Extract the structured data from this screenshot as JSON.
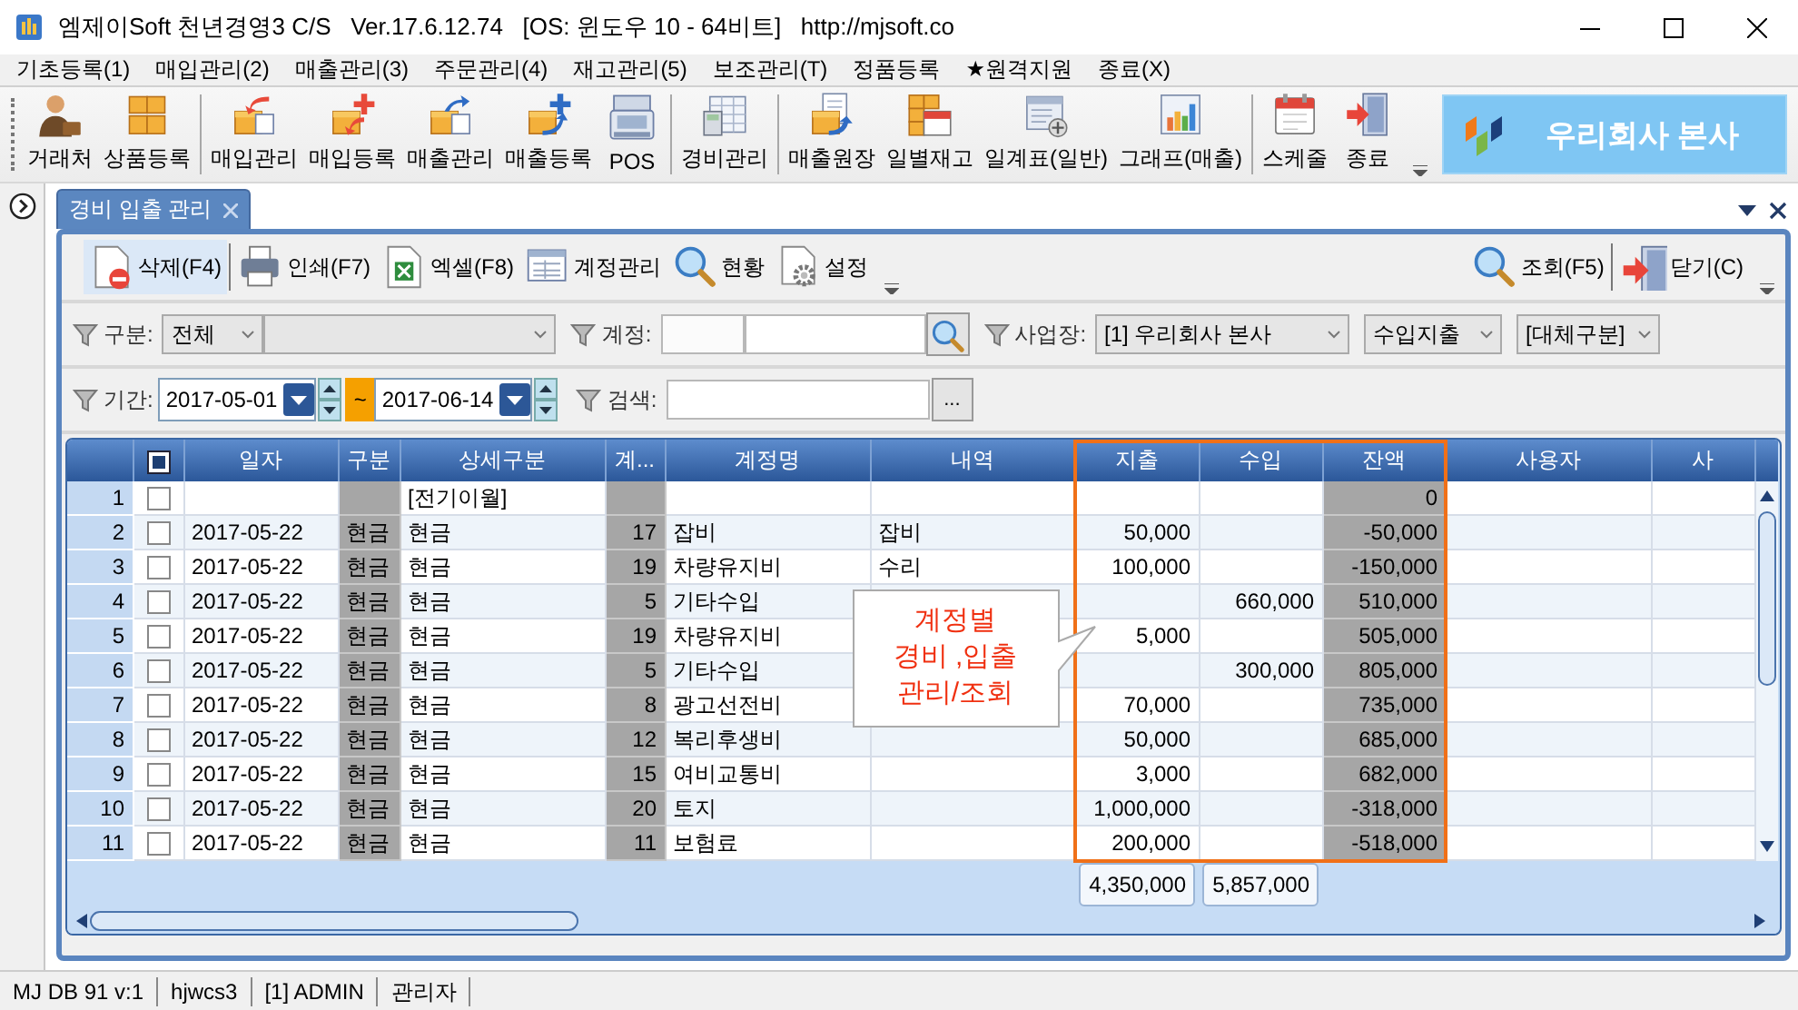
{
  "window": {
    "title": "엠제이Soft 천년경영3 C/S   Ver.17.6.12.74   [OS: 윈도우 10 - 64비트]   http://mjsoft.co"
  },
  "menu": [
    "기초등록(1)",
    "매입관리(2)",
    "매출관리(3)",
    "주문관리(4)",
    "재고관리(5)",
    "보조관리(T)",
    "정품등록",
    "★원격지원",
    "종료(X)"
  ],
  "toolbar": [
    [
      "거래처",
      "상품등록"
    ],
    [
      "매입관리",
      "매입등록",
      "매출관리",
      "매출등록",
      "POS"
    ],
    [
      "경비관리"
    ],
    [
      "매출원장",
      "일별재고",
      "일계표(일반)",
      "그래프(매출)"
    ],
    [
      "스케줄",
      "종료"
    ]
  ],
  "banner": {
    "text": "우리회사 본사"
  },
  "tabs": [
    {
      "label": "경비 입출 관리",
      "selected": true
    }
  ],
  "actions": {
    "left": [
      {
        "label": "삭제(F4)",
        "highlighted": true
      },
      {
        "label": "인쇄(F7)",
        "highlighted": false
      },
      {
        "label": "엑셀(F8)",
        "highlighted": false
      },
      {
        "label": "계정관리",
        "highlighted": false
      },
      {
        "label": "현황",
        "highlighted": false
      },
      {
        "label": "설정",
        "highlighted": false
      }
    ],
    "right": [
      {
        "label": "조회(F5)",
        "highlighted": false
      },
      {
        "label": "닫기(C)",
        "highlighted": false
      }
    ]
  },
  "filters": [
    [
      {
        "kind": "label",
        "text": "구분:"
      },
      {
        "kind": "combo",
        "value": "전체"
      },
      {
        "kind": "combo"
      },
      {
        "kind": "label",
        "text": "계정:"
      },
      {
        "kind": "field"
      },
      {
        "kind": "field"
      },
      {
        "kind": "search-button"
      },
      {
        "kind": "label",
        "text": "사업장:"
      },
      {
        "kind": "combo",
        "value": "[1] 우리회사 본사"
      },
      {
        "kind": "combo",
        "value": "수입지출"
      },
      {
        "kind": "combo",
        "value": "[대체구분]"
      }
    ],
    [
      {
        "kind": "label",
        "text": "기간:"
      },
      {
        "kind": "date",
        "value": "2017-05-01"
      },
      {
        "kind": "range",
        "text": "~"
      },
      {
        "kind": "date",
        "value": "2017-06-14"
      },
      {
        "kind": "label",
        "text": "검색:"
      },
      {
        "kind": "field"
      },
      {
        "kind": "button",
        "text": "..."
      }
    ]
  ],
  "grid": {
    "select_all": {
      "checked": true
    },
    "columns": [
      {
        "label": "일자",
        "kind": "text",
        "shaded": false,
        "highlighted": false
      },
      {
        "label": "구분",
        "kind": "text",
        "shaded": true,
        "highlighted": false
      },
      {
        "label": "상세구분",
        "kind": "text",
        "shaded": false,
        "highlighted": false
      },
      {
        "label": "계...",
        "kind": "number",
        "shaded": true,
        "highlighted": false
      },
      {
        "label": "계정명",
        "kind": "text",
        "shaded": false,
        "highlighted": false
      },
      {
        "label": "내역",
        "kind": "text",
        "shaded": false,
        "highlighted": false
      },
      {
        "label": "지출",
        "kind": "number",
        "shaded": false,
        "highlighted": true,
        "total": "4,350,000"
      },
      {
        "label": "수입",
        "kind": "number",
        "shaded": false,
        "highlighted": true,
        "total": "5,857,000"
      },
      {
        "label": "잔액",
        "kind": "number",
        "shaded": true,
        "highlighted": true
      },
      {
        "label": "사용자",
        "kind": "text",
        "shaded": false,
        "highlighted": false
      },
      {
        "label": "사",
        "kind": "text",
        "shaded": false,
        "highlighted": false
      }
    ],
    "rows": [
      {
        "number": "1",
        "checked": false,
        "cells": [
          null,
          null,
          "[전기이월]",
          null,
          null,
          null,
          null,
          null,
          "0",
          null,
          null
        ]
      },
      {
        "number": "2",
        "checked": false,
        "cells": [
          "2017-05-22",
          "현금",
          "현금",
          "17",
          "잡비",
          "잡비",
          "50,000",
          null,
          "-50,000",
          null,
          null
        ]
      },
      {
        "number": "3",
        "checked": false,
        "cells": [
          "2017-05-22",
          "현금",
          "현금",
          "19",
          "차량유지비",
          "수리",
          "100,000",
          null,
          "-150,000",
          null,
          null
        ]
      },
      {
        "number": "4",
        "checked": false,
        "cells": [
          "2017-05-22",
          "현금",
          "현금",
          "5",
          "기타수입",
          null,
          null,
          "660,000",
          "510,000",
          null,
          null
        ]
      },
      {
        "number": "5",
        "checked": false,
        "cells": [
          "2017-05-22",
          "현금",
          "현금",
          "19",
          "차량유지비",
          null,
          "5,000",
          null,
          "505,000",
          null,
          null
        ]
      },
      {
        "number": "6",
        "checked": false,
        "cells": [
          "2017-05-22",
          "현금",
          "현금",
          "5",
          "기타수입",
          null,
          null,
          "300,000",
          "805,000",
          null,
          null
        ]
      },
      {
        "number": "7",
        "checked": false,
        "cells": [
          "2017-05-22",
          "현금",
          "현금",
          "8",
          "광고선전비",
          null,
          "70,000",
          null,
          "735,000",
          null,
          null
        ]
      },
      {
        "number": "8",
        "checked": false,
        "cells": [
          "2017-05-22",
          "현금",
          "현금",
          "12",
          "복리후생비",
          null,
          "50,000",
          null,
          "685,000",
          null,
          null
        ]
      },
      {
        "number": "9",
        "checked": false,
        "cells": [
          "2017-05-22",
          "현금",
          "현금",
          "15",
          "여비교통비",
          null,
          "3,000",
          null,
          "682,000",
          null,
          null
        ]
      },
      {
        "number": "10",
        "checked": false,
        "cells": [
          "2017-05-22",
          "현금",
          "현금",
          "20",
          "토지",
          null,
          "1,000,000",
          null,
          "-318,000",
          null,
          null
        ]
      },
      {
        "number": "11",
        "checked": false,
        "cells": [
          "2017-05-22",
          "현금",
          "현금",
          "11",
          "보험료",
          null,
          "200,000",
          null,
          "-518,000",
          null,
          null
        ]
      }
    ]
  },
  "callout": {
    "lines": [
      "계정별",
      "경비 ,입출",
      "관리/조회"
    ]
  },
  "status_bar": [
    "MJ DB 91 v:1",
    "hjwcs3",
    "[1] ADMIN",
    "관리자"
  ]
}
